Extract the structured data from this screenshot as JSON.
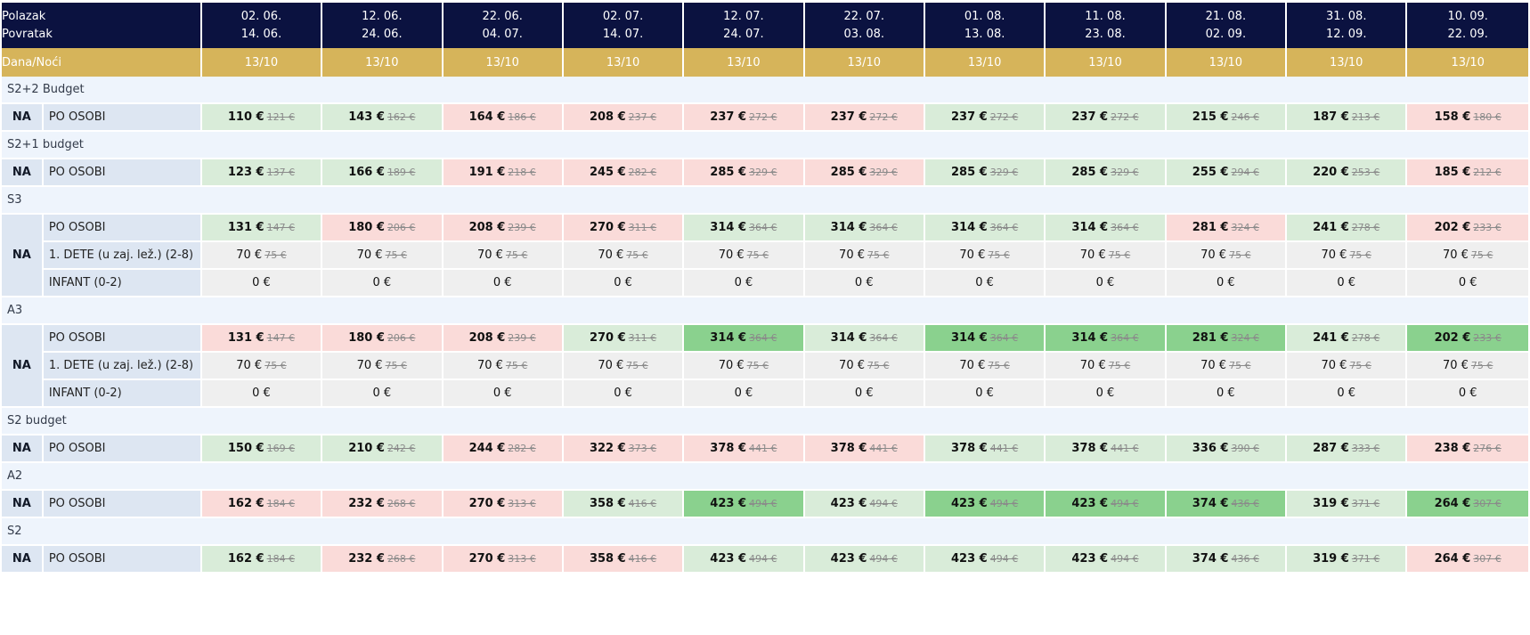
{
  "header": {
    "departure_label": "Polazak",
    "return_label": "Povratak",
    "nights_label": "Dana/Noći",
    "terms": [
      {
        "dep": "02. 06.",
        "ret": "14. 06.",
        "nights": "13/10"
      },
      {
        "dep": "12. 06.",
        "ret": "24. 06.",
        "nights": "13/10"
      },
      {
        "dep": "22. 06.",
        "ret": "04. 07.",
        "nights": "13/10"
      },
      {
        "dep": "02. 07.",
        "ret": "14. 07.",
        "nights": "13/10"
      },
      {
        "dep": "12. 07.",
        "ret": "24. 07.",
        "nights": "13/10"
      },
      {
        "dep": "22. 07.",
        "ret": "03. 08.",
        "nights": "13/10"
      },
      {
        "dep": "01. 08.",
        "ret": "13. 08.",
        "nights": "13/10"
      },
      {
        "dep": "11. 08.",
        "ret": "23. 08.",
        "nights": "13/10"
      },
      {
        "dep": "21. 08.",
        "ret": "02. 09.",
        "nights": "13/10"
      },
      {
        "dep": "31. 08.",
        "ret": "12. 09.",
        "nights": "13/10"
      },
      {
        "dep": "10. 09.",
        "ret": "22. 09.",
        "nights": "13/10"
      }
    ]
  },
  "colors": {
    "green": "#d9ecd9",
    "red": "#fadbd9",
    "dark_green": "#8ad18e",
    "navy": "#0b1240",
    "gold": "#d6b45a"
  },
  "sections": [
    {
      "name": "S2+2 Budget",
      "board": "NA",
      "rows": [
        {
          "label": "PO OSOBI",
          "cells": [
            {
              "new": "110 €",
              "old": "121 €",
              "c": "green"
            },
            {
              "new": "143 €",
              "old": "162 €",
              "c": "green"
            },
            {
              "new": "164 €",
              "old": "186 €",
              "c": "red"
            },
            {
              "new": "208 €",
              "old": "237 €",
              "c": "red"
            },
            {
              "new": "237 €",
              "old": "272 €",
              "c": "red"
            },
            {
              "new": "237 €",
              "old": "272 €",
              "c": "red"
            },
            {
              "new": "237 €",
              "old": "272 €",
              "c": "green"
            },
            {
              "new": "237 €",
              "old": "272 €",
              "c": "green"
            },
            {
              "new": "215 €",
              "old": "246 €",
              "c": "green"
            },
            {
              "new": "187 €",
              "old": "213 €",
              "c": "green"
            },
            {
              "new": "158 €",
              "old": "180 €",
              "c": "red"
            }
          ]
        }
      ]
    },
    {
      "name": "S2+1 budget",
      "board": "NA",
      "rows": [
        {
          "label": "PO OSOBI",
          "cells": [
            {
              "new": "123 €",
              "old": "137 €",
              "c": "green"
            },
            {
              "new": "166 €",
              "old": "189 €",
              "c": "green"
            },
            {
              "new": "191 €",
              "old": "218 €",
              "c": "red"
            },
            {
              "new": "245 €",
              "old": "282 €",
              "c": "red"
            },
            {
              "new": "285 €",
              "old": "329 €",
              "c": "red"
            },
            {
              "new": "285 €",
              "old": "329 €",
              "c": "red"
            },
            {
              "new": "285 €",
              "old": "329 €",
              "c": "green"
            },
            {
              "new": "285 €",
              "old": "329 €",
              "c": "green"
            },
            {
              "new": "255 €",
              "old": "294 €",
              "c": "green"
            },
            {
              "new": "220 €",
              "old": "253 €",
              "c": "green"
            },
            {
              "new": "185 €",
              "old": "212 €",
              "c": "red"
            }
          ]
        }
      ]
    },
    {
      "name": "S3",
      "board": "NA",
      "rows": [
        {
          "label": "PO OSOBI",
          "cells": [
            {
              "new": "131 €",
              "old": "147 €",
              "c": "green"
            },
            {
              "new": "180 €",
              "old": "206 €",
              "c": "red"
            },
            {
              "new": "208 €",
              "old": "239 €",
              "c": "red"
            },
            {
              "new": "270 €",
              "old": "311 €",
              "c": "red"
            },
            {
              "new": "314 €",
              "old": "364 €",
              "c": "green"
            },
            {
              "new": "314 €",
              "old": "364 €",
              "c": "green"
            },
            {
              "new": "314 €",
              "old": "364 €",
              "c": "green"
            },
            {
              "new": "314 €",
              "old": "364 €",
              "c": "green"
            },
            {
              "new": "281 €",
              "old": "324 €",
              "c": "red"
            },
            {
              "new": "241 €",
              "old": "278 €",
              "c": "green"
            },
            {
              "new": "202 €",
              "old": "233 €",
              "c": "red"
            }
          ]
        },
        {
          "label": "1. DETE (u zaj. lež.) (2-8)",
          "cells": [
            {
              "plain": "70 €",
              "old": "75 €",
              "c": "grey"
            },
            {
              "plain": "70 €",
              "old": "75 €",
              "c": "grey"
            },
            {
              "plain": "70 €",
              "old": "75 €",
              "c": "grey"
            },
            {
              "plain": "70 €",
              "old": "75 €",
              "c": "grey"
            },
            {
              "plain": "70 €",
              "old": "75 €",
              "c": "grey"
            },
            {
              "plain": "70 €",
              "old": "75 €",
              "c": "grey"
            },
            {
              "plain": "70 €",
              "old": "75 €",
              "c": "grey"
            },
            {
              "plain": "70 €",
              "old": "75 €",
              "c": "grey"
            },
            {
              "plain": "70 €",
              "old": "75 €",
              "c": "grey"
            },
            {
              "plain": "70 €",
              "old": "75 €",
              "c": "grey"
            },
            {
              "plain": "70 €",
              "old": "75 €",
              "c": "grey"
            }
          ]
        },
        {
          "label": "INFANT (0-2)",
          "cells": [
            {
              "plain": "0 €",
              "c": "grey"
            },
            {
              "plain": "0 €",
              "c": "grey"
            },
            {
              "plain": "0 €",
              "c": "grey"
            },
            {
              "plain": "0 €",
              "c": "grey"
            },
            {
              "plain": "0 €",
              "c": "grey"
            },
            {
              "plain": "0 €",
              "c": "grey"
            },
            {
              "plain": "0 €",
              "c": "grey"
            },
            {
              "plain": "0 €",
              "c": "grey"
            },
            {
              "plain": "0 €",
              "c": "grey"
            },
            {
              "plain": "0 €",
              "c": "grey"
            },
            {
              "plain": "0 €",
              "c": "grey"
            }
          ]
        }
      ]
    },
    {
      "name": "A3",
      "board": "NA",
      "rows": [
        {
          "label": "PO OSOBI",
          "cells": [
            {
              "new": "131 €",
              "old": "147 €",
              "c": "red"
            },
            {
              "new": "180 €",
              "old": "206 €",
              "c": "red"
            },
            {
              "new": "208 €",
              "old": "239 €",
              "c": "red"
            },
            {
              "new": "270 €",
              "old": "311 €",
              "c": "green"
            },
            {
              "new": "314 €",
              "old": "364 €",
              "c": "dgreen"
            },
            {
              "new": "314 €",
              "old": "364 €",
              "c": "green"
            },
            {
              "new": "314 €",
              "old": "364 €",
              "c": "dgreen"
            },
            {
              "new": "314 €",
              "old": "364 €",
              "c": "dgreen"
            },
            {
              "new": "281 €",
              "old": "324 €",
              "c": "dgreen"
            },
            {
              "new": "241 €",
              "old": "278 €",
              "c": "green"
            },
            {
              "new": "202 €",
              "old": "233 €",
              "c": "dgreen"
            }
          ]
        },
        {
          "label": "1. DETE (u zaj. lež.) (2-8)",
          "cells": [
            {
              "plain": "70 €",
              "old": "75 €",
              "c": "grey"
            },
            {
              "plain": "70 €",
              "old": "75 €",
              "c": "grey"
            },
            {
              "plain": "70 €",
              "old": "75 €",
              "c": "grey"
            },
            {
              "plain": "70 €",
              "old": "75 €",
              "c": "grey"
            },
            {
              "plain": "70 €",
              "old": "75 €",
              "c": "grey"
            },
            {
              "plain": "70 €",
              "old": "75 €",
              "c": "grey"
            },
            {
              "plain": "70 €",
              "old": "75 €",
              "c": "grey"
            },
            {
              "plain": "70 €",
              "old": "75 €",
              "c": "grey"
            },
            {
              "plain": "70 €",
              "old": "75 €",
              "c": "grey"
            },
            {
              "plain": "70 €",
              "old": "75 €",
              "c": "grey"
            },
            {
              "plain": "70 €",
              "old": "75 €",
              "c": "grey"
            }
          ]
        },
        {
          "label": "INFANT (0-2)",
          "cells": [
            {
              "plain": "0 €",
              "c": "grey"
            },
            {
              "plain": "0 €",
              "c": "grey"
            },
            {
              "plain": "0 €",
              "c": "grey"
            },
            {
              "plain": "0 €",
              "c": "grey"
            },
            {
              "plain": "0 €",
              "c": "grey"
            },
            {
              "plain": "0 €",
              "c": "grey"
            },
            {
              "plain": "0 €",
              "c": "grey"
            },
            {
              "plain": "0 €",
              "c": "grey"
            },
            {
              "plain": "0 €",
              "c": "grey"
            },
            {
              "plain": "0 €",
              "c": "grey"
            },
            {
              "plain": "0 €",
              "c": "grey"
            }
          ]
        }
      ]
    },
    {
      "name": "S2 budget",
      "board": "NA",
      "rows": [
        {
          "label": "PO OSOBI",
          "cells": [
            {
              "new": "150 €",
              "old": "169 €",
              "c": "green"
            },
            {
              "new": "210 €",
              "old": "242 €",
              "c": "green"
            },
            {
              "new": "244 €",
              "old": "282 €",
              "c": "red"
            },
            {
              "new": "322 €",
              "old": "373 €",
              "c": "red"
            },
            {
              "new": "378 €",
              "old": "441 €",
              "c": "red"
            },
            {
              "new": "378 €",
              "old": "441 €",
              "c": "red"
            },
            {
              "new": "378 €",
              "old": "441 €",
              "c": "green"
            },
            {
              "new": "378 €",
              "old": "441 €",
              "c": "green"
            },
            {
              "new": "336 €",
              "old": "390 €",
              "c": "green"
            },
            {
              "new": "287 €",
              "old": "333 €",
              "c": "green"
            },
            {
              "new": "238 €",
              "old": "276 €",
              "c": "red"
            }
          ]
        }
      ]
    },
    {
      "name": "A2",
      "board": "NA",
      "rows": [
        {
          "label": "PO OSOBI",
          "cells": [
            {
              "new": "162 €",
              "old": "184 €",
              "c": "red"
            },
            {
              "new": "232 €",
              "old": "268 €",
              "c": "red"
            },
            {
              "new": "270 €",
              "old": "313 €",
              "c": "red"
            },
            {
              "new": "358 €",
              "old": "416 €",
              "c": "green"
            },
            {
              "new": "423 €",
              "old": "494 €",
              "c": "dgreen"
            },
            {
              "new": "423 €",
              "old": "494 €",
              "c": "green"
            },
            {
              "new": "423 €",
              "old": "494 €",
              "c": "dgreen"
            },
            {
              "new": "423 €",
              "old": "494 €",
              "c": "dgreen"
            },
            {
              "new": "374 €",
              "old": "436 €",
              "c": "dgreen"
            },
            {
              "new": "319 €",
              "old": "371 €",
              "c": "green"
            },
            {
              "new": "264 €",
              "old": "307 €",
              "c": "dgreen"
            }
          ]
        }
      ]
    },
    {
      "name": "S2",
      "board": "NA",
      "rows": [
        {
          "label": "PO OSOBI",
          "cells": [
            {
              "new": "162 €",
              "old": "184 €",
              "c": "green"
            },
            {
              "new": "232 €",
              "old": "268 €",
              "c": "red"
            },
            {
              "new": "270 €",
              "old": "313 €",
              "c": "red"
            },
            {
              "new": "358 €",
              "old": "416 €",
              "c": "red"
            },
            {
              "new": "423 €",
              "old": "494 €",
              "c": "green"
            },
            {
              "new": "423 €",
              "old": "494 €",
              "c": "green"
            },
            {
              "new": "423 €",
              "old": "494 €",
              "c": "green"
            },
            {
              "new": "423 €",
              "old": "494 €",
              "c": "green"
            },
            {
              "new": "374 €",
              "old": "436 €",
              "c": "green"
            },
            {
              "new": "319 €",
              "old": "371 €",
              "c": "green"
            },
            {
              "new": "264 €",
              "old": "307 €",
              "c": "red"
            }
          ]
        }
      ]
    }
  ]
}
